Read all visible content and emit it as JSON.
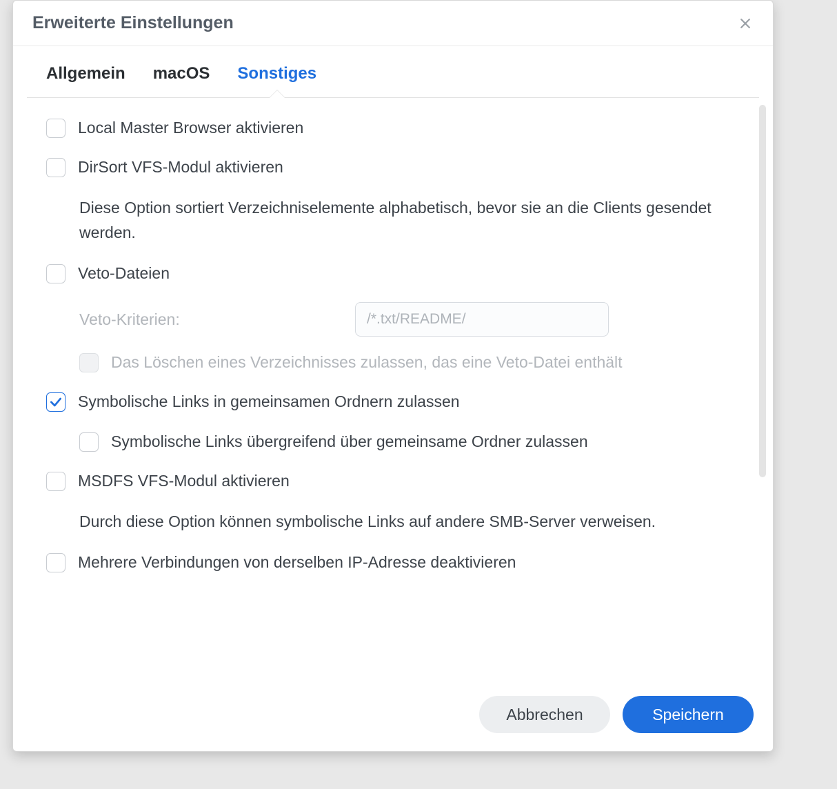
{
  "dialog": {
    "title": "Erweiterte Einstellungen"
  },
  "tabs": {
    "general": "Allgemein",
    "macos": "macOS",
    "other": "Sonstiges"
  },
  "options": {
    "local_master": {
      "label": "Local Master Browser aktivieren",
      "checked": false
    },
    "dirsort": {
      "label": "DirSort VFS-Modul aktivieren",
      "desc": "Diese Option sortiert Verzeichniselemente alphabetisch, bevor sie an die Clients gesendet werden.",
      "checked": false
    },
    "veto": {
      "label": "Veto-Dateien",
      "checked": false,
      "criteria_label": "Veto-Kriterien:",
      "criteria_placeholder": "/*.txt/README/",
      "criteria_value": "",
      "allow_delete_label": "Das Löschen eines Verzeichnisses zulassen, das eine Veto-Datei enthält",
      "allow_delete_checked": false,
      "allow_delete_disabled": true
    },
    "symlinks": {
      "label": "Symbolische Links in gemeinsamen Ordnern zulassen",
      "checked": true,
      "wide_label": "Symbolische Links übergreifend über gemeinsame Ordner zulassen",
      "wide_checked": false
    },
    "msdfs": {
      "label": "MSDFS VFS-Modul aktivieren",
      "desc": "Durch diese Option können symbolische Links auf andere SMB-Server verweisen.",
      "checked": false
    },
    "multi_ip": {
      "label": "Mehrere Verbindungen von derselben IP-Adresse deaktivieren",
      "checked": false
    }
  },
  "footer": {
    "cancel": "Abbrechen",
    "save": "Speichern"
  }
}
